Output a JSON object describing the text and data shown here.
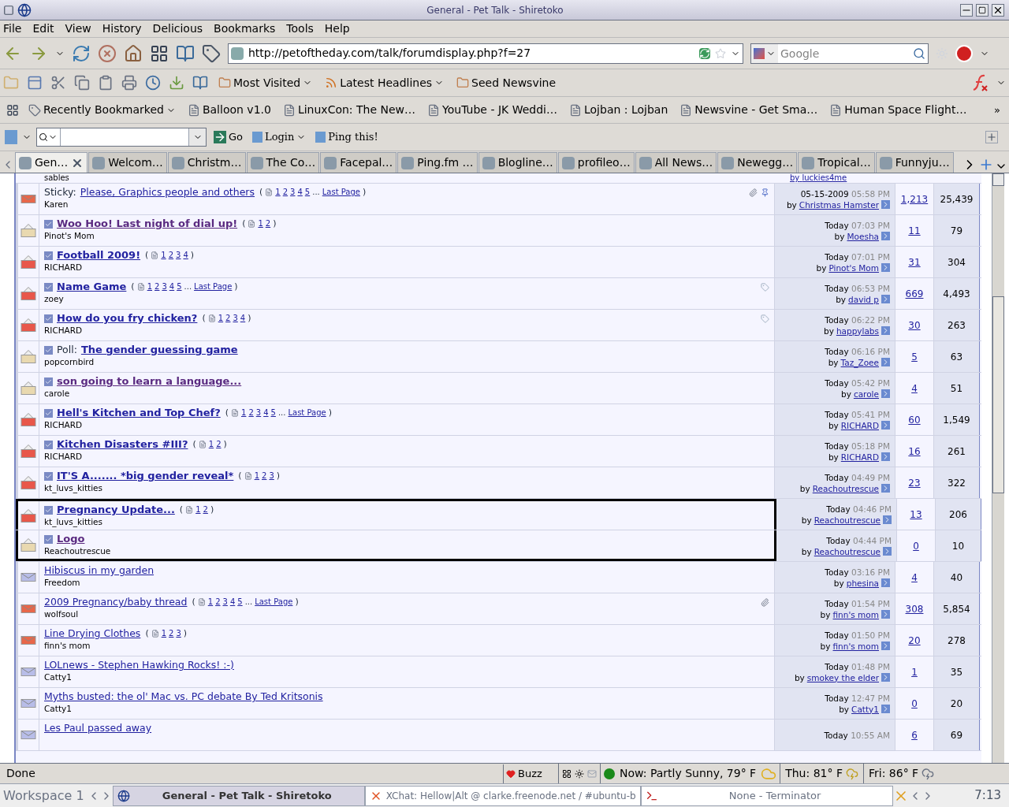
{
  "window": {
    "title": "General - Pet Talk - Shiretoko"
  },
  "menu": [
    "File",
    "Edit",
    "View",
    "History",
    "Delicious",
    "Bookmarks",
    "Tools",
    "Help"
  ],
  "address": {
    "value": "http://petoftheday.com/talk/forumdisplay.php?f=27"
  },
  "search": {
    "placeholder": "Google"
  },
  "bookmarks_top": [
    "Most Visited",
    "Latest Headlines",
    "Seed Newsvine"
  ],
  "bookmarks": {
    "menu": "Recently Bookmarked",
    "items": [
      "Balloon v1.0",
      "LinuxCon: The New…",
      "YouTube - JK Weddi…",
      "Lojban : Lojban",
      "Newsvine - Get Sma…",
      "Human Space Flight…"
    ],
    "more": "»"
  },
  "ping_toolbar": {
    "go": "Go",
    "login": "Login",
    "ping": "Ping this!"
  },
  "tabs": [
    {
      "label": "Gen…",
      "selected": true
    },
    {
      "label": "Welcom…",
      "selected": false
    },
    {
      "label": "Christm…",
      "selected": false
    },
    {
      "label": "The Co…",
      "selected": false
    },
    {
      "label": "Facepal…",
      "selected": false
    },
    {
      "label": "Ping.fm …",
      "selected": false
    },
    {
      "label": "Blogline…",
      "selected": false
    },
    {
      "label": "profileo…",
      "selected": false
    },
    {
      "label": "All News…",
      "selected": false
    },
    {
      "label": "Newegg…",
      "selected": false
    },
    {
      "label": "Tropical…",
      "selected": false
    },
    {
      "label": "Funnyju…",
      "selected": false
    }
  ],
  "partial_row": {
    "author": "sables",
    "by": "by",
    "last_by": "luckies4me"
  },
  "threads": [
    {
      "kind": "hot",
      "prefix": "Sticky:",
      "title": "Please, Graphics people and others",
      "unread": false,
      "visited": false,
      "posted": false,
      "pager": {
        "open": "(",
        "pages": [
          "1",
          "2",
          "3",
          "4",
          "5"
        ],
        "ellipsis": "...",
        "last_page": "Last Page",
        "close": ")"
      },
      "author": "Karen",
      "attachment": true,
      "sticky_pin": true,
      "tagged": false,
      "date": "05-15-2009",
      "time": "05:58 PM",
      "by": "by",
      "last_by": "Christmas Hamster",
      "replies": "1,213",
      "views": "25,439",
      "framed": false
    },
    {
      "kind": "new",
      "title": "Woo Hoo! Last night of dial up!",
      "unread": true,
      "visited": true,
      "posted": true,
      "pager": {
        "open": "(",
        "pages": [
          "1",
          "2"
        ],
        "close": ")"
      },
      "author": "Pinot's Mom",
      "attachment": false,
      "sticky_pin": false,
      "tagged": false,
      "date": "Today",
      "time": "07:03 PM",
      "by": "by",
      "last_by": "Moesha",
      "replies": "11",
      "views": "79",
      "framed": false
    },
    {
      "kind": "hot_new",
      "title": "Football 2009!",
      "unread": true,
      "visited": false,
      "posted": true,
      "pager": {
        "open": "(",
        "pages": [
          "1",
          "2",
          "3",
          "4"
        ],
        "close": ")"
      },
      "author": "RICHARD",
      "attachment": false,
      "sticky_pin": false,
      "tagged": false,
      "date": "Today",
      "time": "07:01 PM",
      "by": "by",
      "last_by": "Pinot's Mom",
      "replies": "31",
      "views": "304",
      "framed": false
    },
    {
      "kind": "hot_new",
      "title": "Name Game",
      "unread": true,
      "visited": false,
      "posted": true,
      "pager": {
        "open": "(",
        "pages": [
          "1",
          "2",
          "3",
          "4",
          "5"
        ],
        "ellipsis": "...",
        "last_page": "Last Page",
        "close": ")"
      },
      "author": "zoey",
      "attachment": false,
      "sticky_pin": false,
      "tagged": true,
      "date": "Today",
      "time": "06:53 PM",
      "by": "by",
      "last_by": "david p",
      "replies": "669",
      "views": "4,493",
      "framed": false
    },
    {
      "kind": "hot_new",
      "title": "How do you fry chicken?",
      "unread": true,
      "visited": false,
      "posted": true,
      "pager": {
        "open": "(",
        "pages": [
          "1",
          "2",
          "3",
          "4"
        ],
        "close": ")"
      },
      "author": "RICHARD",
      "attachment": false,
      "sticky_pin": false,
      "tagged": true,
      "date": "Today",
      "time": "06:22 PM",
      "by": "by",
      "last_by": "happylabs",
      "replies": "30",
      "views": "263",
      "framed": false
    },
    {
      "kind": "new",
      "prefix": "Poll:",
      "title": "The gender guessing game",
      "unread": true,
      "visited": false,
      "posted": true,
      "author": "popcornbird",
      "attachment": false,
      "sticky_pin": false,
      "tagged": false,
      "date": "Today",
      "time": "06:16 PM",
      "by": "by",
      "last_by": "Taz_Zoee",
      "replies": "5",
      "views": "63",
      "framed": false
    },
    {
      "kind": "new",
      "title": "son going to learn a language...",
      "unread": true,
      "visited": true,
      "posted": true,
      "author": "carole",
      "attachment": false,
      "sticky_pin": false,
      "tagged": false,
      "date": "Today",
      "time": "05:42 PM",
      "by": "by",
      "last_by": "carole",
      "replies": "4",
      "views": "51",
      "framed": false
    },
    {
      "kind": "hot_new",
      "title": "Hell's Kitchen and Top Chef?",
      "unread": true,
      "visited": false,
      "posted": true,
      "pager": {
        "open": "(",
        "pages": [
          "1",
          "2",
          "3",
          "4",
          "5"
        ],
        "ellipsis": "...",
        "last_page": "Last Page",
        "close": ")"
      },
      "author": "RICHARD",
      "attachment": false,
      "sticky_pin": false,
      "tagged": false,
      "date": "Today",
      "time": "05:41 PM",
      "by": "by",
      "last_by": "RICHARD",
      "replies": "60",
      "views": "1,549",
      "framed": false
    },
    {
      "kind": "hot_new",
      "title": "Kitchen Disasters #III?",
      "unread": true,
      "visited": false,
      "posted": true,
      "pager": {
        "open": "(",
        "pages": [
          "1",
          "2"
        ],
        "close": ")"
      },
      "author": "RICHARD",
      "attachment": false,
      "sticky_pin": false,
      "tagged": false,
      "date": "Today",
      "time": "05:18 PM",
      "by": "by",
      "last_by": "RICHARD",
      "replies": "16",
      "views": "261",
      "framed": false
    },
    {
      "kind": "hot_new",
      "title": "IT'S A....... *big gender reveal*",
      "unread": true,
      "visited": false,
      "posted": true,
      "pager": {
        "open": "(",
        "pages": [
          "1",
          "2",
          "3"
        ],
        "close": ")"
      },
      "author": "kt_luvs_kitties",
      "attachment": false,
      "sticky_pin": false,
      "tagged": false,
      "date": "Today",
      "time": "04:49 PM",
      "by": "by",
      "last_by": "Reachoutrescue",
      "replies": "23",
      "views": "322",
      "framed": false
    },
    {
      "kind": "hot_new",
      "title": "Pregnancy Update...",
      "unread": true,
      "visited": false,
      "posted": true,
      "pager": {
        "open": "(",
        "pages": [
          "1",
          "2"
        ],
        "close": ")"
      },
      "author": "kt_luvs_kitties",
      "attachment": false,
      "sticky_pin": false,
      "tagged": false,
      "date": "Today",
      "time": "04:46 PM",
      "by": "by",
      "last_by": "Reachoutrescue",
      "replies": "13",
      "views": "206",
      "framed": true
    },
    {
      "kind": "new",
      "title": "Logo",
      "unread": true,
      "visited": true,
      "posted": true,
      "author": "Reachoutrescue",
      "attachment": false,
      "sticky_pin": false,
      "tagged": false,
      "date": "Today",
      "time": "04:44 PM",
      "by": "by",
      "last_by": "Reachoutrescue",
      "replies": "0",
      "views": "10",
      "framed": true
    },
    {
      "kind": "old",
      "title": "Hibiscus in my garden",
      "unread": false,
      "visited": false,
      "posted": false,
      "author": "Freedom",
      "attachment": false,
      "sticky_pin": false,
      "tagged": false,
      "date": "Today",
      "time": "03:16 PM",
      "by": "by",
      "last_by": "phesina",
      "replies": "4",
      "views": "40",
      "framed": false
    },
    {
      "kind": "hot",
      "title": "2009 Pregnancy/baby thread",
      "unread": false,
      "visited": false,
      "posted": false,
      "pager": {
        "open": "(",
        "pages": [
          "1",
          "2",
          "3",
          "4",
          "5"
        ],
        "ellipsis": "...",
        "last_page": "Last Page",
        "close": ")"
      },
      "author": "wolfsoul",
      "attachment": true,
      "sticky_pin": false,
      "tagged": false,
      "date": "Today",
      "time": "01:54 PM",
      "by": "by",
      "last_by": "finn's mom",
      "replies": "308",
      "views": "5,854",
      "framed": false
    },
    {
      "kind": "hot",
      "title": "Line Drying Clothes",
      "unread": false,
      "visited": false,
      "posted": false,
      "pager": {
        "open": "(",
        "pages": [
          "1",
          "2",
          "3"
        ],
        "close": ")"
      },
      "author": "finn's mom",
      "attachment": false,
      "sticky_pin": false,
      "tagged": false,
      "date": "Today",
      "time": "01:50 PM",
      "by": "by",
      "last_by": "finn's mom",
      "replies": "20",
      "views": "278",
      "framed": false
    },
    {
      "kind": "old",
      "title": "LOLnews - Stephen Hawking Rocks! :-)",
      "unread": false,
      "visited": false,
      "posted": false,
      "author": "Catty1",
      "attachment": false,
      "sticky_pin": false,
      "tagged": false,
      "date": "Today",
      "time": "01:48 PM",
      "by": "by",
      "last_by": "smokey the elder",
      "replies": "1",
      "views": "35",
      "framed": false
    },
    {
      "kind": "old",
      "title": "Myths busted: the ol' Mac vs. PC debate By Ted Kritsonis",
      "unread": false,
      "visited": false,
      "posted": false,
      "author": "Catty1",
      "attachment": false,
      "sticky_pin": false,
      "tagged": false,
      "date": "Today",
      "time": "12:47 PM",
      "by": "by",
      "last_by": "Catty1",
      "replies": "0",
      "views": "20",
      "framed": false
    },
    {
      "kind": "old",
      "title": "Les Paul passed away",
      "unread": false,
      "visited": false,
      "posted": false,
      "attachment": false,
      "sticky_pin": false,
      "tagged": false,
      "date": "Today",
      "time": "10:55 AM",
      "replies": "6",
      "views": "69",
      "framed": false
    }
  ],
  "status_bar": {
    "text": "Done",
    "buzz": "Buzz",
    "weather_now": "Now: Partly Sunny, 79° F",
    "weather_thu": "Thu: 81° F",
    "weather_fri": "Fri: 86° F"
  },
  "taskbar": {
    "workspace": "Workspace 1",
    "windows": [
      {
        "label": "General - Pet Talk - Shiretoko",
        "selected": true
      },
      {
        "label": "XChat: Hellow|Alt @ clarke.freenode.net / #ubuntu-b",
        "selected": false
      },
      {
        "label": "None - Terminator",
        "selected": false
      }
    ],
    "clock": "7:13"
  }
}
